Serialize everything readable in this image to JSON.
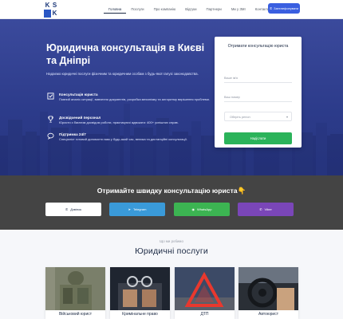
{
  "header": {
    "logo_letters": [
      "K",
      "S",
      "K"
    ],
    "nav": [
      {
        "label": "Головна",
        "active": true
      },
      {
        "label": "Послуги",
        "active": false
      },
      {
        "label": "Про компанію",
        "active": false
      },
      {
        "label": "Відгуки",
        "active": false
      },
      {
        "label": "Партнери",
        "active": false
      },
      {
        "label": "Ми у ЗМІ",
        "active": false
      },
      {
        "label": "Контакти",
        "active": false
      }
    ],
    "cta_label": "Зателефонувати"
  },
  "hero": {
    "title": "Юридична консультація в Києві та Дніпрі",
    "lead": "Надаємо юридичні послуги фізичним та юридичним особам з будь-якої галузі законодавства.",
    "features": [
      {
        "icon": "checklist-icon",
        "title": "Консультація юриста",
        "desc": "Повний аналіз ситуації, вивчення документів, розробка механізму та алгоритму вирішення проблеми."
      },
      {
        "icon": "trophy-icon",
        "title": "Досвідчений персонал",
        "desc": "Юристи з багатим досвідом роботи, практикуючі адвокати: 400+ успішних справ."
      },
      {
        "icon": "chat-icon",
        "title": "Підтримка 24/7",
        "desc": "Спеціаліст готовий допомогти вам у будь-який час, велика та дистанційні консультації."
      }
    ]
  },
  "form": {
    "title": "Отримати консультацію юриста",
    "name_placeholder": "Ваше ім'я",
    "phone_placeholder": "Ваш номер",
    "region_placeholder": "Оберіть регіон",
    "submit_label": "Надіслати"
  },
  "quick": {
    "title": "Отримайте швидку консультацію юриста",
    "buttons": [
      {
        "label": "Дзвінок",
        "icon": "phone-icon"
      },
      {
        "label": "Telegram",
        "icon": "telegram-icon"
      },
      {
        "label": "WhatsApp",
        "icon": "whatsapp-icon"
      },
      {
        "label": "Viber",
        "icon": "viber-icon"
      }
    ]
  },
  "services": {
    "kicker": "Що ми робимо",
    "title": "Юридичні послуги",
    "cards": [
      {
        "caption": "Військовий юрист"
      },
      {
        "caption": "Кримінальне право"
      },
      {
        "caption": "ДТП"
      },
      {
        "caption": "Автоюрист"
      }
    ]
  },
  "colors": {
    "brand_blue": "#3a5fe0",
    "submit_green": "#2bb35a",
    "telegram": "#3a9ad9",
    "whatsapp": "#3cb452",
    "viber": "#7a46b8"
  }
}
